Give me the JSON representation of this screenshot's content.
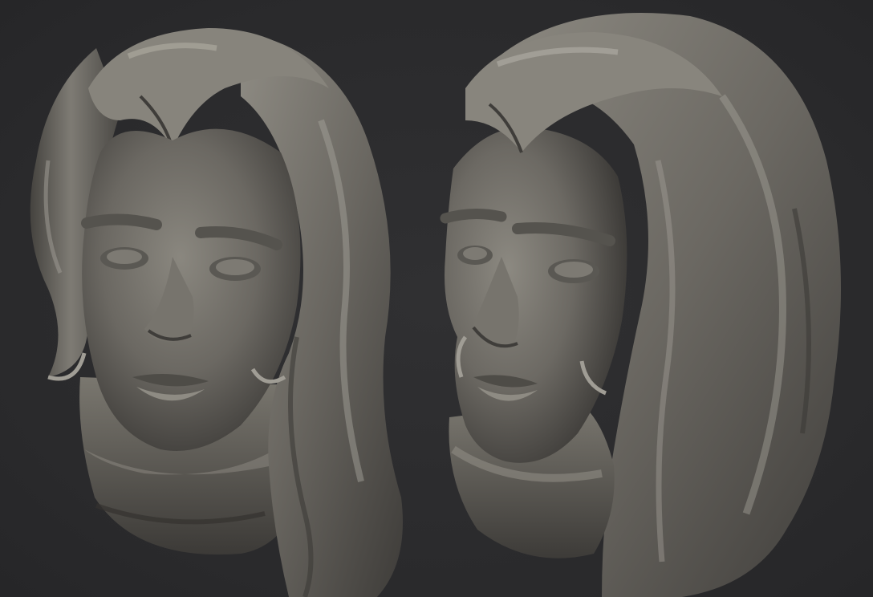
{
  "scene": {
    "background_color": "#2b2b2d",
    "material_color": "#6f6c66",
    "views": [
      {
        "id": "front",
        "subject": "sculpted-female-head"
      },
      {
        "id": "three-quarter",
        "subject": "sculpted-female-head"
      }
    ]
  }
}
